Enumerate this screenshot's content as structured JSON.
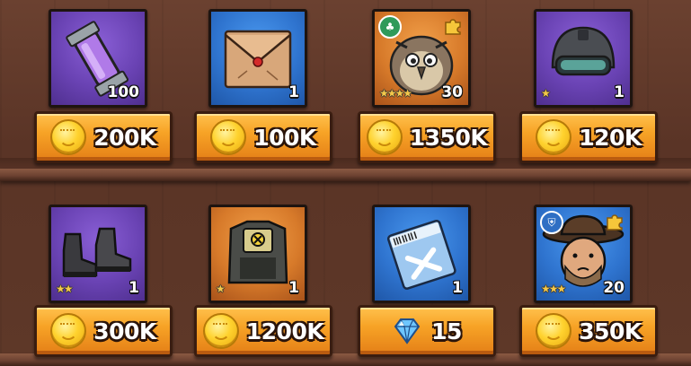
{
  "shop": {
    "rows": [
      {
        "items": [
          {
            "name": "purple-potion-tube",
            "rarity": "purple",
            "quantity": "100",
            "stars": 0,
            "price": "200K",
            "currency": "coin"
          },
          {
            "name": "envelope",
            "rarity": "blue",
            "quantity": "1",
            "stars": 0,
            "price": "100K",
            "currency": "coin"
          },
          {
            "name": "owl-hero-shard",
            "rarity": "orange",
            "quantity": "30",
            "stars": 4,
            "price": "1350K",
            "currency": "coin"
          },
          {
            "name": "combat-helmet",
            "rarity": "purple",
            "quantity": "1",
            "stars": 1,
            "price": "120K",
            "currency": "coin"
          }
        ]
      },
      {
        "items": [
          {
            "name": "combat-boots",
            "rarity": "purple",
            "quantity": "1",
            "stars": 2,
            "price": "300K",
            "currency": "coin"
          },
          {
            "name": "body-armor-vest",
            "rarity": "orange",
            "quantity": "1",
            "stars": 1,
            "price": "1200K",
            "currency": "coin"
          },
          {
            "name": "supply-packet",
            "rarity": "blue",
            "quantity": "1",
            "stars": 0,
            "price": "15",
            "currency": "gem"
          },
          {
            "name": "cowboy-hero-shard",
            "rarity": "blue",
            "quantity": "20",
            "stars": 3,
            "price": "350K",
            "currency": "coin"
          }
        ]
      }
    ]
  },
  "colors": {
    "coin": "#ffd22e",
    "gem": "#6ec6ff",
    "price_button": "#f7a326",
    "shelf": "#6e4232"
  }
}
